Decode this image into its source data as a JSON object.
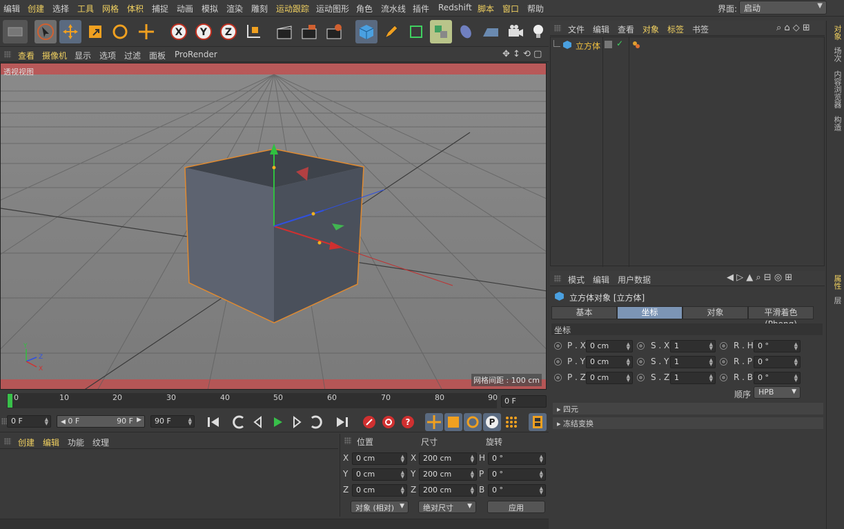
{
  "menubar": {
    "items": [
      {
        "label": "编辑",
        "hl": false
      },
      {
        "label": "创建",
        "hl": true
      },
      {
        "label": "选择",
        "hl": false
      },
      {
        "label": "工具",
        "hl": true
      },
      {
        "label": "网格",
        "hl": true
      },
      {
        "label": "体积",
        "hl": true
      },
      {
        "label": "捕捉",
        "hl": false
      },
      {
        "label": "动画",
        "hl": false
      },
      {
        "label": "模拟",
        "hl": false
      },
      {
        "label": "渲染",
        "hl": false
      },
      {
        "label": "雕刻",
        "hl": false
      },
      {
        "label": "运动跟踪",
        "hl": true
      },
      {
        "label": "运动图形",
        "hl": false
      },
      {
        "label": "角色",
        "hl": false
      },
      {
        "label": "流水线",
        "hl": false
      },
      {
        "label": "插件",
        "hl": false
      },
      {
        "label": "Redshift",
        "hl": false
      },
      {
        "label": "脚本",
        "hl": true
      },
      {
        "label": "窗口",
        "hl": true
      },
      {
        "label": "帮助",
        "hl": false
      }
    ],
    "layout_label": "界面:",
    "layout_value": "启动"
  },
  "viewport_menu": {
    "items": [
      "查看",
      "摄像机",
      "显示",
      "选项",
      "过滤",
      "面板",
      "ProRender"
    ],
    "label": "透视视图",
    "grid_spacing": "网格间距 : 100 cm",
    "axis_labels": {
      "y": "Y",
      "z": "Z",
      "x": "X"
    }
  },
  "timeline": {
    "ticks": [
      "0",
      "10",
      "20",
      "30",
      "40",
      "50",
      "60",
      "70",
      "80",
      "90"
    ],
    "frame_end_display": "0 F",
    "current_frame": "0 F",
    "range_start": "0 F",
    "range_end": "90 F",
    "max_frame": "90 F"
  },
  "material": {
    "menu": [
      "创建",
      "编辑",
      "功能",
      "纹理"
    ]
  },
  "coords": {
    "headers": {
      "position": "位置",
      "size": "尺寸",
      "rotation": "旋转"
    },
    "rows": [
      {
        "axis": "X",
        "pos": "0 cm",
        "size_axis": "X",
        "size": "200 cm",
        "rot_axis": "H",
        "rot": "0 °"
      },
      {
        "axis": "Y",
        "pos": "0 cm",
        "size_axis": "Y",
        "size": "200 cm",
        "rot_axis": "P",
        "rot": "0 °"
      },
      {
        "axis": "Z",
        "pos": "0 cm",
        "size_axis": "Z",
        "size": "200 cm",
        "rot_axis": "B",
        "rot": "0 °"
      }
    ],
    "mode_dropdown": "对象 (相对)",
    "size_dropdown": "绝对尺寸",
    "apply_label": "应用"
  },
  "object_manager": {
    "menu": [
      "文件",
      "编辑",
      "查看",
      "对象",
      "标签",
      "书签"
    ],
    "menu_hl": [
      false,
      false,
      false,
      true,
      true,
      false
    ],
    "object_name": "立方体"
  },
  "attributes": {
    "menu": [
      "模式",
      "编辑",
      "用户数据"
    ],
    "title": "立方体对象 [立方体]",
    "tabs": [
      "基本",
      "坐标",
      "对象",
      "平滑着色(Phong)"
    ],
    "selected_tab": 1,
    "section_title": "坐标",
    "params": [
      {
        "label": "P . X",
        "value": "0 cm"
      },
      {
        "label": "S . X",
        "value": "1"
      },
      {
        "label": "R . H",
        "value": "0 °"
      },
      {
        "label": "P . Y",
        "value": "0 cm"
      },
      {
        "label": "S . Y",
        "value": "1"
      },
      {
        "label": "R . P",
        "value": "0 °"
      },
      {
        "label": "P . Z",
        "value": "0 cm"
      },
      {
        "label": "S . Z",
        "value": "1"
      },
      {
        "label": "R . B",
        "value": "0 °"
      }
    ],
    "order_label": "顺序",
    "order_value": "HPB",
    "collapsed": [
      "四元",
      "冻结变换"
    ]
  },
  "right_strip": {
    "tabs_top": [
      "对象",
      "场次",
      "内容浏览器",
      "构造"
    ],
    "tabs_bottom": [
      "属性",
      "层"
    ]
  },
  "colors": {
    "accent": "#f0d060",
    "selected_tab": "#7c95b5",
    "play_green": "#38c04a",
    "cube_outline": "#e08a30"
  }
}
